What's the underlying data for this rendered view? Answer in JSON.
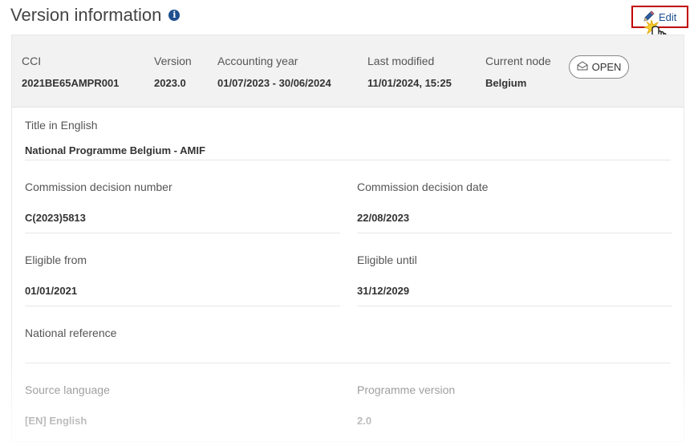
{
  "page": {
    "title": "Version information"
  },
  "toolbar": {
    "edit_label": "Edit"
  },
  "header": {
    "cci": {
      "label": "CCI",
      "value": "2021BE65AMPR001"
    },
    "version": {
      "label": "Version",
      "value": "2023.0"
    },
    "accounting_year": {
      "label": "Accounting year",
      "value": "01/07/2023 - 30/06/2024"
    },
    "last_modified": {
      "label": "Last modified",
      "value": "11/01/2024, 15:25"
    },
    "current_node": {
      "label": "Current node",
      "value": "Belgium"
    },
    "status": {
      "label": "OPEN"
    }
  },
  "fields": {
    "title_en": {
      "label": "Title in English",
      "value": "National Programme Belgium - AMIF"
    },
    "decision_number": {
      "label": "Commission decision number",
      "value": "C(2023)5813"
    },
    "decision_date": {
      "label": "Commission decision date",
      "value": "22/08/2023"
    },
    "eligible_from": {
      "label": "Eligible from",
      "value": "01/01/2021"
    },
    "eligible_until": {
      "label": "Eligible until",
      "value": "31/12/2029"
    },
    "national_reference": {
      "label": "National reference",
      "value": ""
    },
    "source_language": {
      "label": "Source language",
      "value": "[EN] English"
    },
    "programme_version": {
      "label": "Programme version",
      "value": "2.0"
    }
  },
  "colors": {
    "accent": "#1f4f8f",
    "edit_highlight": "#c00000",
    "header_bg": "#f2f2f2"
  }
}
